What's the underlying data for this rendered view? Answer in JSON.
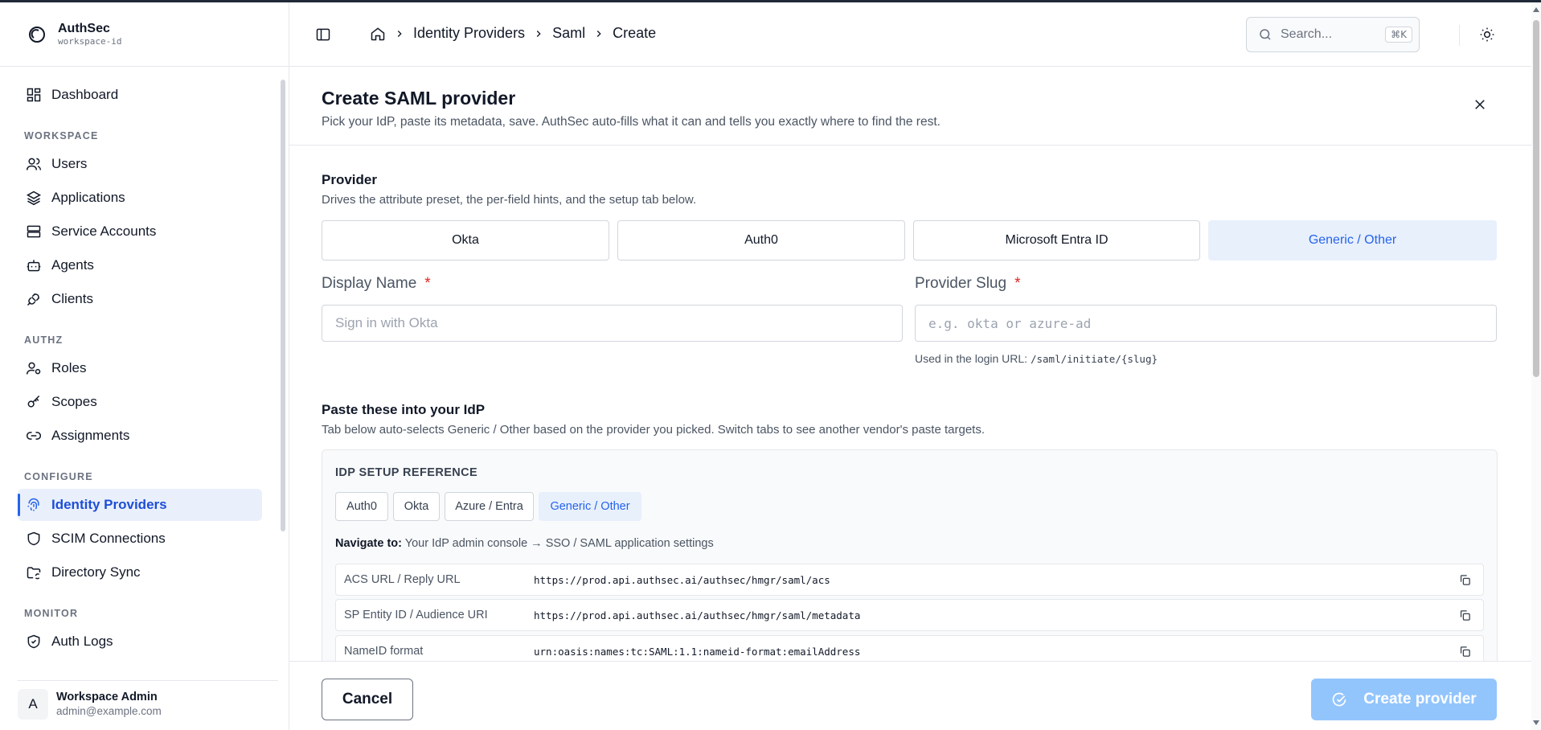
{
  "brand": {
    "name": "AuthSec",
    "workspace": "workspace-id"
  },
  "sidebar": {
    "dashboard": "Dashboard",
    "sections": {
      "workspace": "WORKSPACE",
      "authz": "AUTHZ",
      "configure": "CONFIGURE",
      "monitor": "MONITOR"
    },
    "items": {
      "users": "Users",
      "applications": "Applications",
      "service_accounts": "Service Accounts",
      "agents": "Agents",
      "clients": "Clients",
      "roles": "Roles",
      "scopes": "Scopes",
      "assignments": "Assignments",
      "identity_providers": "Identity Providers",
      "scim": "SCIM Connections",
      "directory_sync": "Directory Sync",
      "auth_logs": "Auth Logs"
    },
    "user": {
      "initial": "A",
      "name": "Workspace Admin",
      "email": "admin@example.com"
    }
  },
  "header": {
    "breadcrumb": [
      "Identity Providers",
      "Saml",
      "Create"
    ],
    "search_placeholder": "Search...",
    "search_shortcut": "⌘K"
  },
  "page": {
    "title": "Create SAML provider",
    "subtitle": "Pick your IdP, paste its metadata, save. AuthSec auto-fills what it can and tells you exactly where to find the rest."
  },
  "provider": {
    "title": "Provider",
    "subtitle": "Drives the attribute preset, the per-field hints, and the setup tab below.",
    "options": [
      "Okta",
      "Auth0",
      "Microsoft Entra ID",
      "Generic / Other"
    ],
    "selected": "Generic / Other"
  },
  "fields": {
    "display_name": {
      "label": "Display Name",
      "required": "*",
      "placeholder": "Sign in with Okta",
      "value": ""
    },
    "slug": {
      "label": "Provider Slug",
      "required": "*",
      "placeholder": "e.g. okta or azure-ad",
      "value": "",
      "hint_prefix": "Used in the login URL:",
      "hint_code": "/saml/initiate/{slug}"
    }
  },
  "paste": {
    "title": "Paste these into your IdP",
    "subtitle": "Tab below auto-selects Generic / Other based on the provider you picked. Switch tabs to see another vendor's paste targets."
  },
  "reference": {
    "title": "IDP SETUP REFERENCE",
    "tabs": [
      "Auth0",
      "Okta",
      "Azure / Entra",
      "Generic / Other"
    ],
    "selected_tab": "Generic / Other",
    "navigate_label": "Navigate to:",
    "navigate_text": "Your IdP admin console → SSO / SAML application settings",
    "rows": [
      {
        "key": "ACS URL / Reply URL",
        "value": "https://prod.api.authsec.ai/authsec/hmgr/saml/acs"
      },
      {
        "key": "SP Entity ID / Audience URI",
        "value": "https://prod.api.authsec.ai/authsec/hmgr/saml/metadata"
      },
      {
        "key": "NameID format",
        "value": "urn:oasis:names:tc:SAML:1.1:nameid-format:emailAddress"
      }
    ]
  },
  "footer": {
    "cancel": "Cancel",
    "create": "Create provider"
  }
}
